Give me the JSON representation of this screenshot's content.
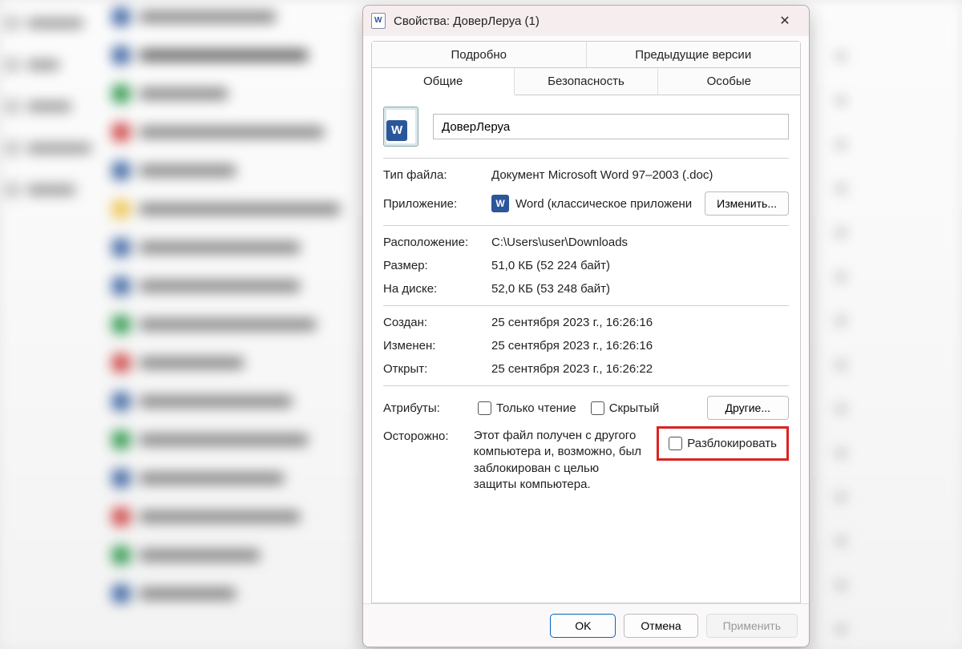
{
  "window": {
    "title": "Свойства: ДоверЛеруа (1)"
  },
  "tabs_top": [
    "Подробно",
    "Предыдущие версии"
  ],
  "tabs_bottom": [
    "Общие",
    "Безопасность",
    "Особые"
  ],
  "active_tab": "Общие",
  "file": {
    "name": "ДоверЛеруа",
    "type_label": "Тип файла:",
    "type_value": "Документ Microsoft Word 97–2003 (.doc)",
    "app_label": "Приложение:",
    "app_value": "Word (классическое приложени",
    "change_btn": "Изменить...",
    "location_label": "Расположение:",
    "location_value": "C:\\Users\\user\\Downloads",
    "size_label": "Размер:",
    "size_value": "51,0 КБ (52 224 байт)",
    "disk_label": "На диске:",
    "disk_value": "52,0 КБ (53 248 байт)",
    "created_label": "Создан:",
    "created_value": "25 сентября 2023 г., 16:26:16",
    "modified_label": "Изменен:",
    "modified_value": "25 сентября 2023 г., 16:26:16",
    "opened_label": "Открыт:",
    "opened_value": "25 сентября 2023 г., 16:26:22"
  },
  "attributes": {
    "label": "Атрибуты:",
    "readonly": "Только чтение",
    "hidden": "Скрытый",
    "other_btn": "Другие..."
  },
  "security": {
    "label": "Осторожно:",
    "text": "Этот файл получен с другого компьютера и, возможно, был заблокирован с целью защиты компьютера.",
    "unblock": "Разблокировать"
  },
  "footer": {
    "ok": "OK",
    "cancel": "Отмена",
    "apply": "Применить"
  }
}
